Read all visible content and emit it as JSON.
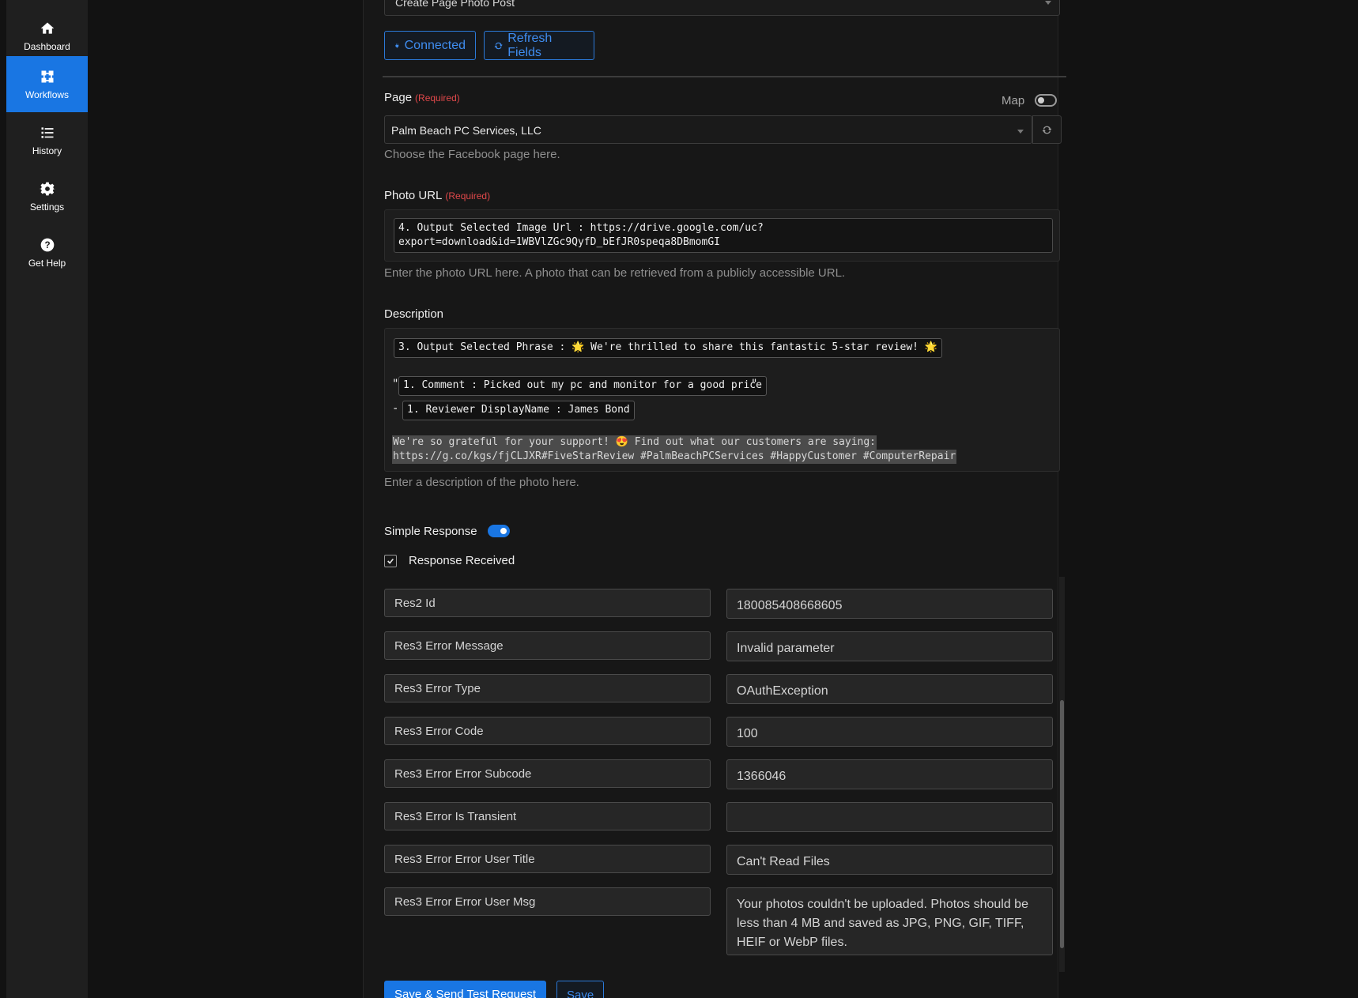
{
  "sidebar": {
    "items": [
      {
        "label": "Dashboard",
        "icon": "home-icon"
      },
      {
        "label": "Workflows",
        "icon": "workflows-icon"
      },
      {
        "label": "History",
        "icon": "list-icon"
      },
      {
        "label": "Settings",
        "icon": "gear-icon"
      },
      {
        "label": "Get Help",
        "icon": "question-icon"
      }
    ],
    "active": "Workflows"
  },
  "action_select": {
    "value": "Create Page Photo Post"
  },
  "toolbar": {
    "connected_label": "Connected",
    "refresh_label": "Refresh Fields"
  },
  "page_field": {
    "label": "Page",
    "required": "(Required)",
    "map_label": "Map",
    "value": "Palm Beach PC Services, LLC",
    "help": "Choose the Facebook page here."
  },
  "photo_url": {
    "label": "Photo URL",
    "required": "(Required)",
    "line1": "4. Output Selected Image Url : https://drive.google.com/uc?",
    "line2": "export=download&id=1WBVlZGc9QyfD_bEfJR0speqa8DBmomGI",
    "help": "Enter the photo URL here. A photo that can be retrieved from a publicly accessible URL."
  },
  "description": {
    "label": "Description",
    "phrase_pill": "3. Output Selected Phrase : 🌟 We're thrilled to share this fantastic 5-star review! 🌟",
    "quote_open": "\"",
    "comment_pill": "1. Comment : Picked out my pc and monitor for a good price",
    "quote_close": "\"",
    "dash": "-",
    "reviewer_pill": "1. Reviewer DisplayName : James Bond",
    "text_line1": "We're so grateful for your support! 😍 Find out what our customers are saying:",
    "text_line2": "https://g.co/kgs/fjCLJXR#FiveStarReview #PalmBeachPCServices #HappyCustomer #ComputerRepair",
    "help": "Enter a description of the photo here."
  },
  "simple_response": {
    "label": "Simple Response",
    "enabled": true
  },
  "response_received": {
    "label": "Response Received",
    "checked": true
  },
  "responses": [
    {
      "key": "Res2 Id",
      "value": "180085408668605"
    },
    {
      "key": "Res3 Error Message",
      "value": "Invalid parameter"
    },
    {
      "key": "Res3 Error Type",
      "value": "OAuthException"
    },
    {
      "key": "Res3 Error Code",
      "value": "100"
    },
    {
      "key": "Res3 Error Error Subcode",
      "value": "1366046"
    },
    {
      "key": "Res3 Error Is Transient",
      "value": ""
    },
    {
      "key": "Res3 Error Error User Title",
      "value": "Can't Read Files"
    },
    {
      "key": "Res3 Error Error User Msg",
      "value": "Your photos couldn't be uploaded. Photos should be less than 4 MB and saved as JPG, PNG, GIF, TIFF, HEIF or WebP files."
    }
  ],
  "footer": {
    "send_label": "Save & Send Test Request",
    "save_label": "Save"
  },
  "colors": {
    "accent": "#1976e3",
    "required": "#e0484a"
  }
}
